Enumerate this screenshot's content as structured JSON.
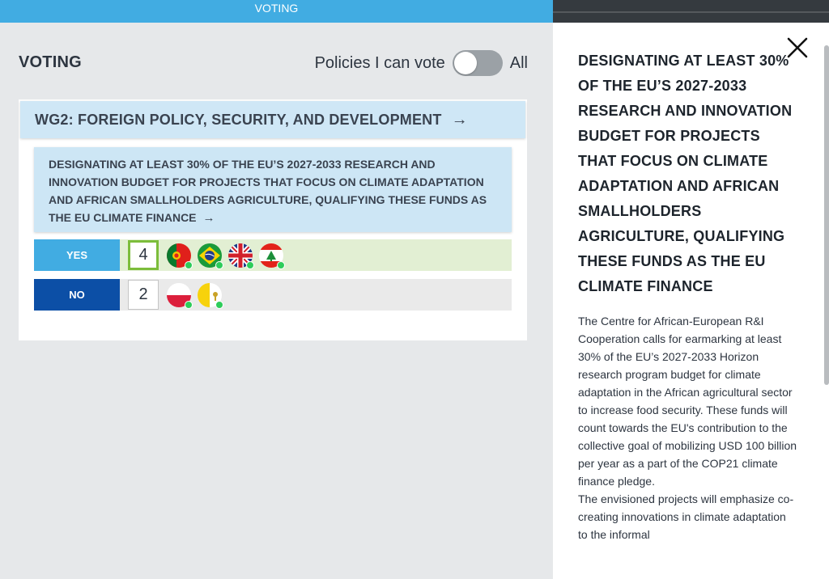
{
  "topbar": {
    "title": "VOTING"
  },
  "voting": {
    "heading": "VOTING",
    "filter_label": "Policies I can vote",
    "filter_alt": "All"
  },
  "group": {
    "title": "WG2: FOREIGN POLICY, SECURITY, AND DEVELOPMENT",
    "arrow": "→"
  },
  "policy": {
    "title": "DESIGNATING AT LEAST 30% OF THE EU’S 2027-2033 RESEARCH AND INNOVATION BUDGET FOR PROJECTS THAT FOCUS ON CLIMATE ADAPTATION AND AFRICAN SMALLHOLDERS AGRICULTURE, QUALIFYING THESE FUNDS AS THE EU CLIMATE FINANCE",
    "arrow": "→"
  },
  "votes": {
    "yes": {
      "label": "YES",
      "count": "4",
      "flags": [
        "portugal-flag-icon",
        "brazil-flag-icon",
        "uk-flag-icon",
        "lebanon-flag-icon"
      ]
    },
    "no": {
      "label": "NO",
      "count": "2",
      "flags": [
        "poland-flag-icon",
        "vatican-flag-icon"
      ]
    }
  },
  "panel": {
    "close_icon": "close-icon",
    "title": "DESIGNATING AT LEAST 30% OF THE EU’S 2027-2033 RESEARCH AND INNOVATION BUDGET FOR PROJECTS THAT FOCUS ON CLIMATE ADAPTATION AND AFRICAN SMALLHOLDERS AGRICULTURE, QUALIFYING THESE FUNDS AS THE EU CLIMATE FINANCE",
    "paragraph1": "The Centre for African-European R&I Cooperation calls for earmarking at least 30% of the EU’s 2027-2033 Horizon research program budget for climate adaptation in the African agricultural sector to increase food security. These funds will count towards the EU's contribution to the collective goal of mobilizing USD 100 billion per year as a part of the COP21 climate finance pledge.",
    "paragraph2": "The envisioned projects will emphasize co-creating innovations in climate adaptation to the informal"
  },
  "colors": {
    "accent": "#41ace2",
    "no_button": "#0c4fa6",
    "yes_row": "#e2efd3",
    "highlight": "#7cbd3b",
    "online_dot": "#2ecc5a"
  }
}
